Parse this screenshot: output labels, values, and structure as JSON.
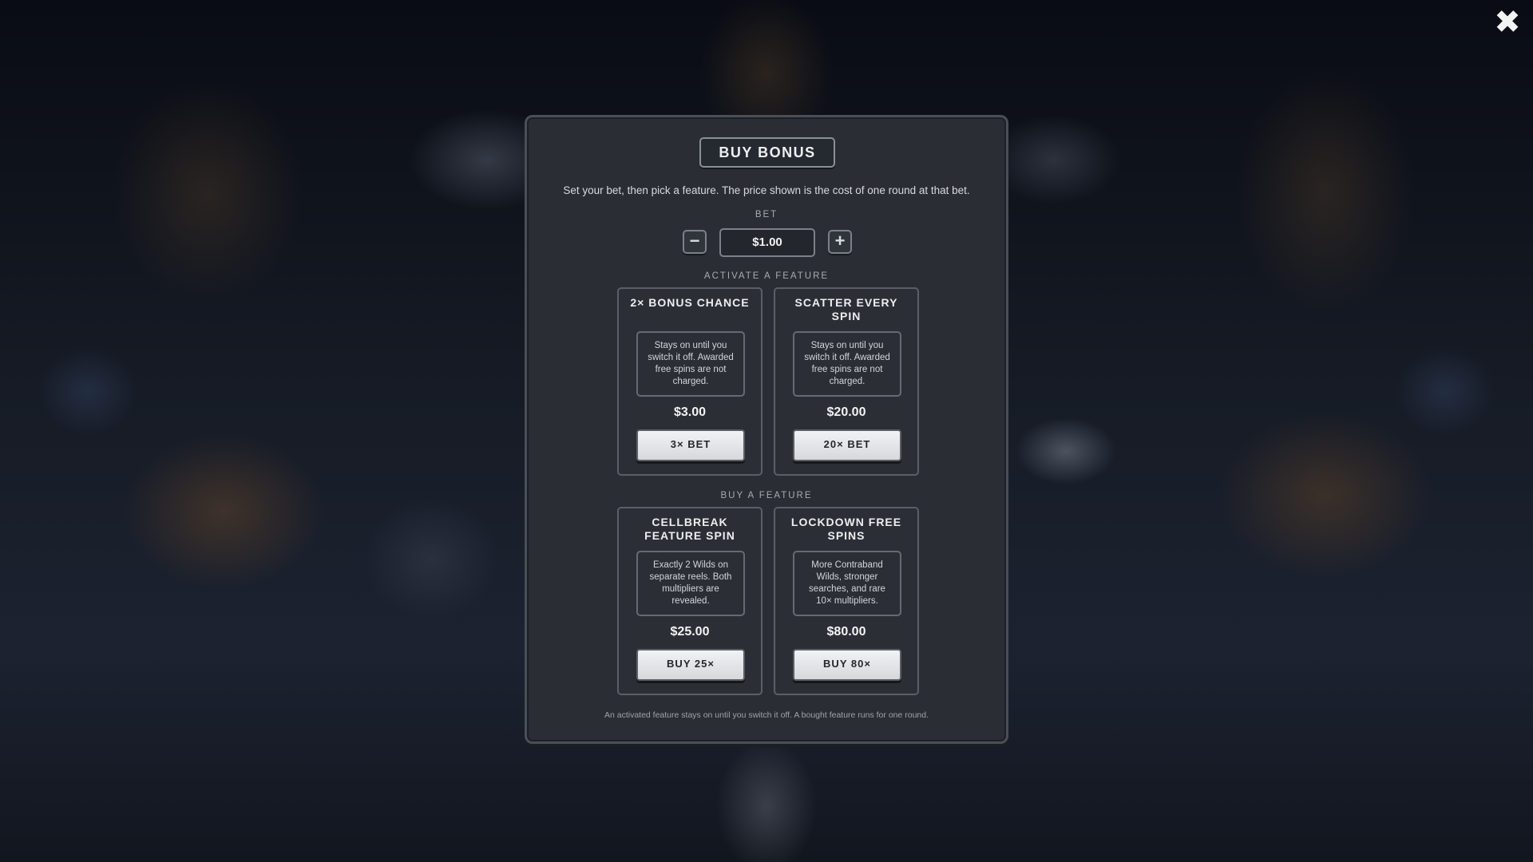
{
  "close": {
    "icon": "close-icon",
    "glyph": "✖"
  },
  "modal": {
    "title": "BUY BONUS",
    "subtitle": "Set your bet, then pick a feature. The price shown is the cost of one round at that bet.",
    "bet": {
      "label": "BET",
      "value": "$1.00",
      "minus": "−",
      "plus": "+"
    },
    "activate_label": "ACTIVATE A FEATURE",
    "buy_label": "BUY A FEATURE",
    "activate_cards": [
      {
        "title": "2× BONUS CHANCE",
        "description": "Stays on until you switch it off. Awarded free spins are not charged.",
        "price": "$3.00",
        "button": "3× BET"
      },
      {
        "title": "SCATTER EVERY SPIN",
        "description": "Stays on until you switch it off. Awarded free spins are not charged.",
        "price": "$20.00",
        "button": "20× BET"
      }
    ],
    "buy_cards": [
      {
        "title": "CELLBREAK FEATURE SPIN",
        "description": "Exactly 2 Wilds on separate reels. Both multipliers are revealed.",
        "price": "$25.00",
        "button": "BUY 25×"
      },
      {
        "title": "LOCKDOWN FREE SPINS",
        "description": "More Contraband Wilds, stronger searches, and rare 10× multipliers.",
        "price": "$80.00",
        "button": "BUY 80×"
      }
    ],
    "footnote": "An activated feature stays on until you switch it off. A bought feature runs for one round."
  }
}
